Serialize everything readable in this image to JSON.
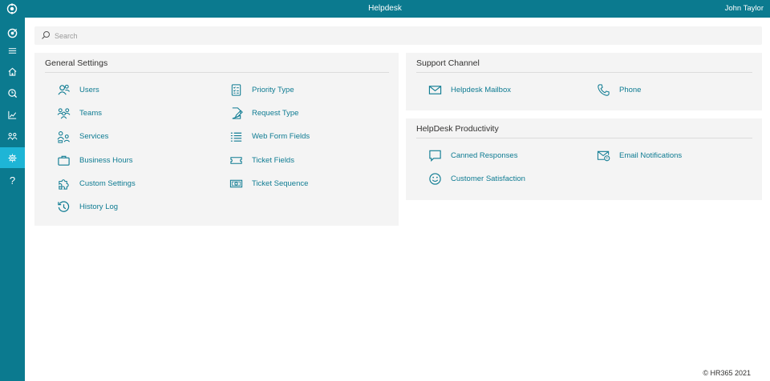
{
  "app": {
    "title": "Helpdesk",
    "user": "John Taylor"
  },
  "colors": {
    "brand": "#0b7a8f",
    "active": "#1eb5d6",
    "link": "#0e7b92",
    "panel": "#f4f4f4"
  },
  "rail": {
    "items": [
      {
        "icon": "target-icon"
      },
      {
        "icon": "menu-icon"
      },
      {
        "icon": "home-icon"
      },
      {
        "icon": "ticket-search-icon"
      },
      {
        "icon": "chart-icon"
      },
      {
        "icon": "users-icon"
      },
      {
        "icon": "gear-icon",
        "active": true
      },
      {
        "icon": "help-icon",
        "text": "?"
      }
    ]
  },
  "search": {
    "placeholder": "Search",
    "value": ""
  },
  "general": {
    "title": "General Settings",
    "left": [
      {
        "label": "Users",
        "icon": "users-icon"
      },
      {
        "label": "Teams",
        "icon": "teams-icon"
      },
      {
        "label": "Services",
        "icon": "services-icon"
      },
      {
        "label": "Business Hours",
        "icon": "briefcase-icon"
      },
      {
        "label": "Custom Settings",
        "icon": "puzzle-icon"
      },
      {
        "label": "History Log",
        "icon": "history-icon"
      }
    ],
    "right": [
      {
        "label": "Priority Type",
        "icon": "checklist-icon"
      },
      {
        "label": "Request Type",
        "icon": "document-edit-icon"
      },
      {
        "label": "Web Form Fields",
        "icon": "list-icon"
      },
      {
        "label": "Ticket Fields",
        "icon": "ticket-icon"
      },
      {
        "label": "Ticket Sequence",
        "icon": "money-icon"
      }
    ]
  },
  "support": {
    "title": "Support Channel",
    "items": [
      {
        "label": "Helpdesk Mailbox",
        "icon": "mail-icon"
      },
      {
        "label": "Phone",
        "icon": "phone-icon"
      }
    ]
  },
  "productivity": {
    "title": "HelpDesk Productivity",
    "items": [
      {
        "label": "Canned Responses",
        "icon": "chat-icon"
      },
      {
        "label": "Email Notifications",
        "icon": "mail-alert-icon"
      },
      {
        "label": "Customer Satisfaction",
        "icon": "smile-icon"
      }
    ]
  },
  "footer": {
    "text": "© HR365 2021"
  }
}
